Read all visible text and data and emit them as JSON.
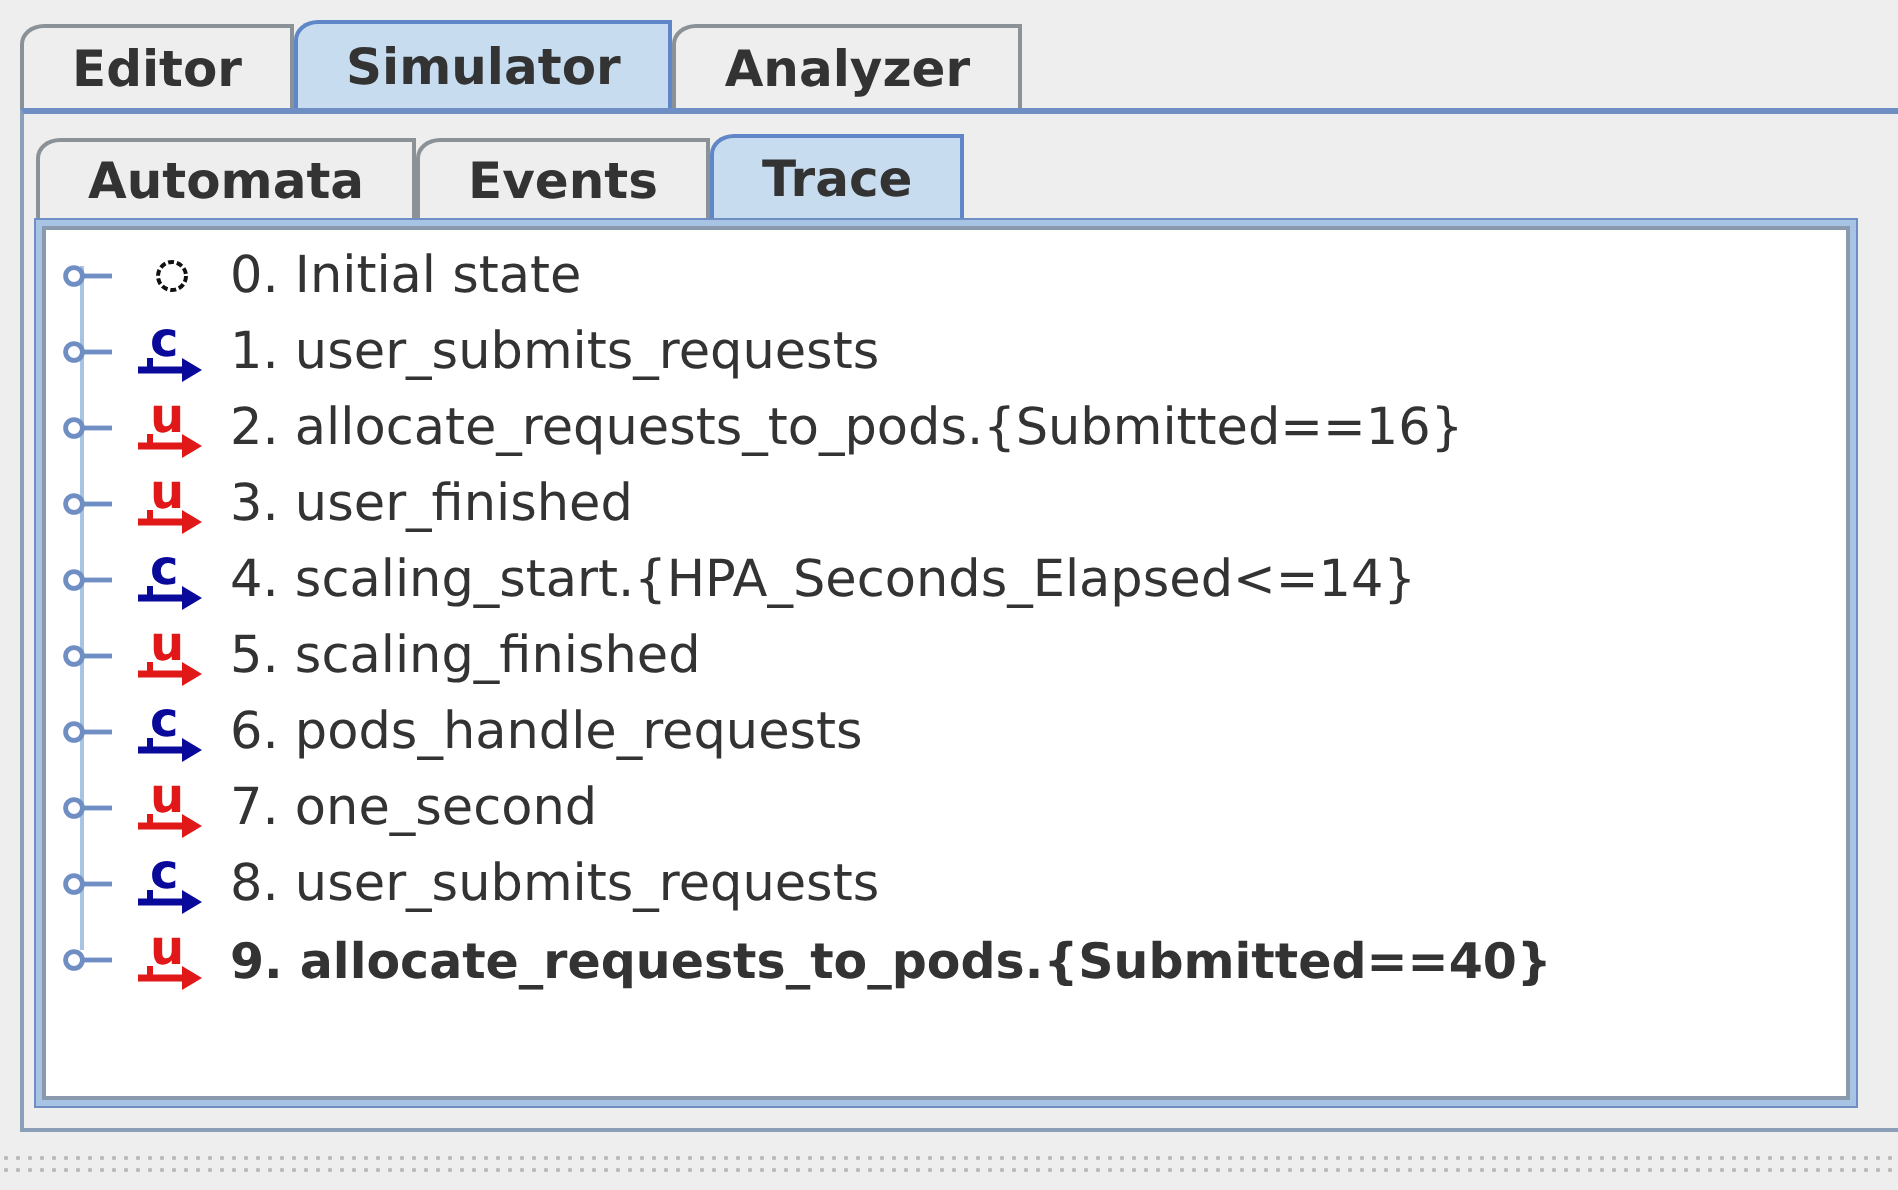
{
  "main_tabs": [
    {
      "label": "Editor",
      "selected": false
    },
    {
      "label": "Simulator",
      "selected": true
    },
    {
      "label": "Analyzer",
      "selected": false
    }
  ],
  "sub_tabs": [
    {
      "label": "Automata",
      "selected": false
    },
    {
      "label": "Events",
      "selected": false
    },
    {
      "label": "Trace",
      "selected": true
    }
  ],
  "trace": [
    {
      "kind": "initial",
      "text": "0. Initial state",
      "current": false
    },
    {
      "kind": "controllable",
      "badge": "c",
      "text": "1. user_submits_requests",
      "current": false
    },
    {
      "kind": "uncontrollable",
      "badge": "u",
      "text": "2. allocate_requests_to_pods.{Submitted==16}",
      "current": false
    },
    {
      "kind": "uncontrollable",
      "badge": "u",
      "text": "3. user_finished",
      "current": false
    },
    {
      "kind": "controllable",
      "badge": "c",
      "text": "4. scaling_start.{HPA_Seconds_Elapsed<=14}",
      "current": false
    },
    {
      "kind": "uncontrollable",
      "badge": "u",
      "text": "5. scaling_finished",
      "current": false
    },
    {
      "kind": "controllable",
      "badge": "c",
      "text": "6. pods_handle_requests",
      "current": false
    },
    {
      "kind": "uncontrollable",
      "badge": "u",
      "text": "7. one_second",
      "current": false
    },
    {
      "kind": "controllable",
      "badge": "c",
      "text": "8. user_submits_requests",
      "current": false
    },
    {
      "kind": "uncontrollable",
      "badge": "u",
      "text": "9. allocate_requests_to_pods.{Submitted==40}",
      "current": true
    }
  ]
}
